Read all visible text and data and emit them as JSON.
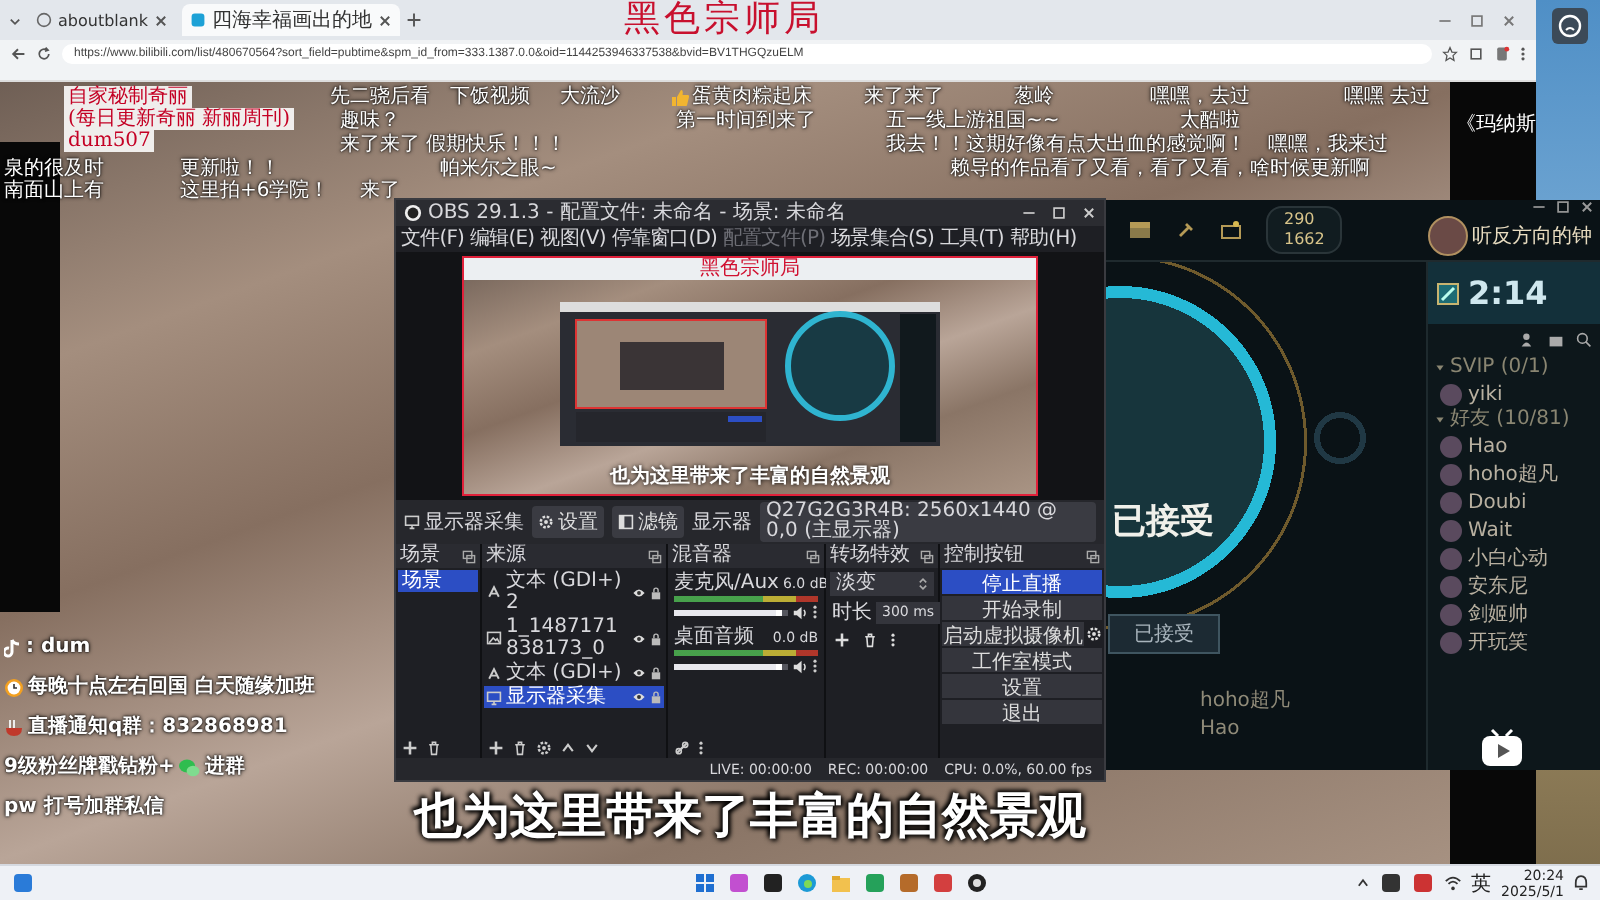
{
  "browser": {
    "tabs": [
      {
        "title": "aboutblank",
        "selected": false
      },
      {
        "title": "四海幸福画出的地",
        "selected": true
      }
    ],
    "url": "https://www.bilibili.com/list/480670564?sort_field=pubtime&spm_id_from=333.1387.0.0&oid=1144253946337538&bvid=BV1THGQzuELM"
  },
  "stream_title": "黑色宗师局",
  "notes": [
    "自家秘制奇丽",
    "(每日更新奇丽 新丽周刊)",
    "dum507"
  ],
  "danmaku": [
    {
      "text": "先二骁后看",
      "kind": "plain"
    },
    {
      "text": "下饭视频",
      "kind": "plain"
    },
    {
      "text": "大流沙",
      "kind": "plain"
    },
    {
      "text": "蛋黄肉粽起床",
      "kind": "thumbs"
    },
    {
      "text": "来了来了",
      "kind": "plain"
    },
    {
      "text": "葱岭",
      "kind": "plain"
    },
    {
      "text": "嘿嘿，去过",
      "kind": "plain"
    },
    {
      "text": "嘿嘿 去过",
      "kind": "plain"
    },
    {
      "text": "趣味？",
      "kind": "plain"
    },
    {
      "text": "第一时间到来了",
      "kind": "plain"
    },
    {
      "text": "五一线上游祖国~~",
      "kind": "plain"
    },
    {
      "text": "太酷啦",
      "kind": "plain"
    },
    {
      "text": "来了来了  假期快乐！！！",
      "kind": "plain"
    },
    {
      "text": "我去！！这期好像有点大出血的感觉啊！",
      "kind": "plain"
    },
    {
      "text": "嘿嘿，我来过",
      "kind": "plain"
    },
    {
      "text": "泉的很及时",
      "kind": "plain"
    },
    {
      "text": "更新啦！！",
      "kind": "plain"
    },
    {
      "text": "帕米尔之眼~",
      "kind": "plain"
    },
    {
      "text": "赖导的作品看了又看，看了又看，啥时候更新啊",
      "kind": "plain"
    },
    {
      "text": "南面山上有",
      "kind": "plain"
    },
    {
      "text": "这里拍+6学院！",
      "kind": "plain"
    },
    {
      "text": "来了",
      "kind": "plain"
    }
  ],
  "side_caption": "《玛纳斯",
  "obs": {
    "title": "OBS 29.1.3 - 配置文件: 未命名 - 场景: 未命名",
    "menu": [
      {
        "label": "文件(F)",
        "disabled": false
      },
      {
        "label": "编辑(E)",
        "disabled": false
      },
      {
        "label": "视图(V)",
        "disabled": false
      },
      {
        "label": "停靠窗口(D)",
        "disabled": false
      },
      {
        "label": "配置文件(P)",
        "disabled": true
      },
      {
        "label": "场景集合(S)",
        "disabled": false
      },
      {
        "label": "工具(T)",
        "disabled": false
      },
      {
        "label": "帮助(H)",
        "disabled": false
      }
    ],
    "preview": {
      "title": "黑色宗师局",
      "subtitle": "也为这里带来了丰富的自然景观"
    },
    "toolbar": {
      "source": "显示器采集",
      "settings": "设置",
      "filters": "滤镜",
      "label": "显示器",
      "display": "Q27G2G3R4B: 2560x1440 @ 0,0 (主显示器)"
    },
    "scenes": {
      "title": "场景",
      "items": [
        {
          "name": "场景",
          "selected": true
        }
      ]
    },
    "sources": {
      "title": "来源",
      "items": [
        {
          "name": "文本 (GDI+) 2",
          "kind": "text",
          "selected": false
        },
        {
          "name": "1_1487171838173_0",
          "kind": "image",
          "selected": false
        },
        {
          "name": "文本 (GDI+)",
          "kind": "text",
          "selected": false
        },
        {
          "name": "显示器采集",
          "kind": "display",
          "selected": true
        }
      ]
    },
    "mixer": {
      "title": "混音器",
      "channels": [
        {
          "name": "麦克风/Aux",
          "reading": "6.0 dB",
          "level": 0.9
        },
        {
          "name": "桌面音频",
          "reading": "0.0 dB",
          "level": 0.9
        }
      ]
    },
    "transitions": {
      "title": "转场特效",
      "type": "淡变",
      "duration_label": "时长",
      "duration": "300 ms"
    },
    "controls": {
      "title": "控制按钮",
      "buttons": [
        {
          "label": "停止直播",
          "active": true
        },
        {
          "label": "开始录制",
          "active": false
        },
        {
          "label": "启动虚拟摄像机",
          "active": false
        },
        {
          "label": "工作室模式",
          "active": false
        },
        {
          "label": "设置",
          "active": false
        },
        {
          "label": "退出",
          "active": false
        }
      ]
    },
    "status": {
      "live": "LIVE: 00:00:00",
      "rec": "REC: 00:00:00",
      "cpu": "CPU: 0.0%, 60.00 fps"
    }
  },
  "game": {
    "currency": [
      "290",
      "1662"
    ],
    "player": "听反方向的钟",
    "timer": "2:14",
    "status_text": "已接受",
    "accept_button": "已接受",
    "party": [
      "hoho超凡",
      "Hao"
    ],
    "friend_groups": [
      {
        "title": "SVIP (0/1)",
        "expanded": true,
        "friends": [
          "yiki"
        ]
      },
      {
        "title": "好友 (10/81)",
        "expanded": true,
        "friends": [
          "Hao",
          "hoho超凡",
          "Doubi",
          "Wait",
          "小白心动",
          "安东尼",
          "剑姬帅",
          "开玩笑"
        ]
      }
    ]
  },
  "info_lines": [
    {
      "kind": "tiktok",
      "text": ": dum"
    },
    {
      "kind": "clock",
      "text": "每晚十点左右回国  白天随缘加班"
    },
    {
      "kind": "noodles",
      "text": "直播通知q群：832868981"
    },
    {
      "kind": "wechat",
      "text": "9级粉丝牌戳钻粉+",
      "after": "进群"
    },
    {
      "kind": "none",
      "text": "pw 打号加群私信"
    }
  ],
  "subtitle": "也为这里带来了丰富的自然景观",
  "taskbar": {
    "ime": "英",
    "time": "20:24",
    "date": "2025/5/1"
  }
}
